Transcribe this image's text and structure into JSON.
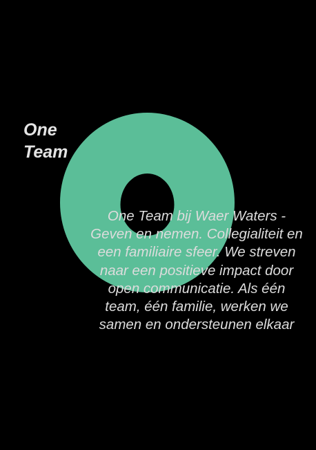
{
  "colors": {
    "background": "#000000",
    "ring": "#5bbe98",
    "heading_text": "#e4e4e4",
    "body_text": "#dcdcdc"
  },
  "heading": {
    "line1": "One",
    "line2": "Team"
  },
  "description": {
    "lines": [
      "One Team bij Waer Waters -",
      "Geven en nemen. Collegialiteit en",
      "een familiaire sfeer. We streven",
      "naar een positieve impact door",
      "open communicatie. Als één",
      "team, één familie, werken we",
      "samen en ondersteunen elkaar"
    ]
  }
}
